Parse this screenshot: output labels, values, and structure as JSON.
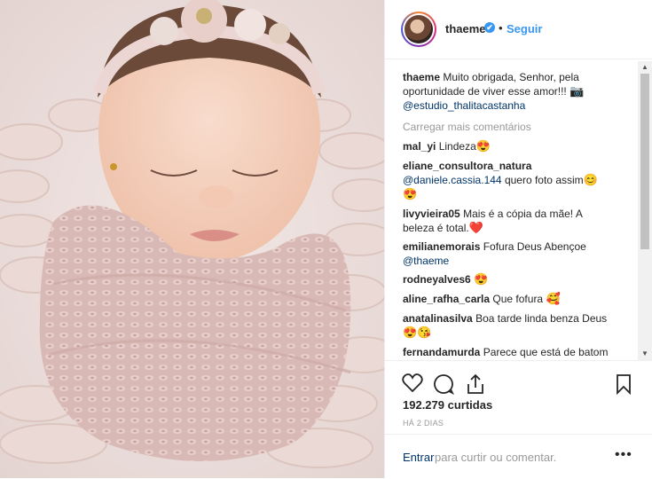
{
  "header": {
    "username": "thaeme",
    "verified_mark": "✔",
    "separator": "•",
    "follow_label": "Seguir"
  },
  "caption": {
    "username": "thaeme",
    "text_line1": "Muito obrigada, Senhor, pela",
    "text_line2": "oportunidade de viver esse amor!!!",
    "camera_emoji": "📷",
    "mention": "@estudio_thalitacastanha"
  },
  "load_more_label": "Carregar mais comentários",
  "comments": [
    {
      "username": "mal_yi",
      "text": "Lindeza",
      "emoji": "😍"
    },
    {
      "username": "eliane_consultora_natura",
      "mention": "@daniele.cassia.144",
      "text": "quero foto assim",
      "emoji": "😊",
      "emoji2": "😍"
    },
    {
      "username": "livyvieira05",
      "text": "Mais é a cópia da mãe! A",
      "text2": "beleza é total.",
      "emoji": "❤️"
    },
    {
      "username": "emilianemorais",
      "text": "Fofura Deus Abençoe",
      "mention": "@thaeme"
    },
    {
      "username": "rodneyalves6",
      "emoji": "😍"
    },
    {
      "username": "aline_rafha_carla",
      "text": "Que fofura",
      "emoji": "🥰"
    },
    {
      "username": "anatalinasilva",
      "text": "Boa tarde linda benza Deus",
      "emoji": "😍😘"
    },
    {
      "username": "fernandamurda",
      "text": "Parece que está de batom"
    }
  ],
  "actions": {
    "like_icon": "heart-icon",
    "comment_icon": "comment-icon",
    "share_icon": "share-icon",
    "save_icon": "bookmark-icon"
  },
  "likes": "192.279 curtidas",
  "time_ago": "HÁ 2 DIAS",
  "add_comment": {
    "login_label": "Entrar",
    "rest_label": "para curtir ou comentar.",
    "more_icon": "•••"
  },
  "colors": {
    "link": "#003569",
    "accent": "#3897f0",
    "muted": "#999999"
  }
}
